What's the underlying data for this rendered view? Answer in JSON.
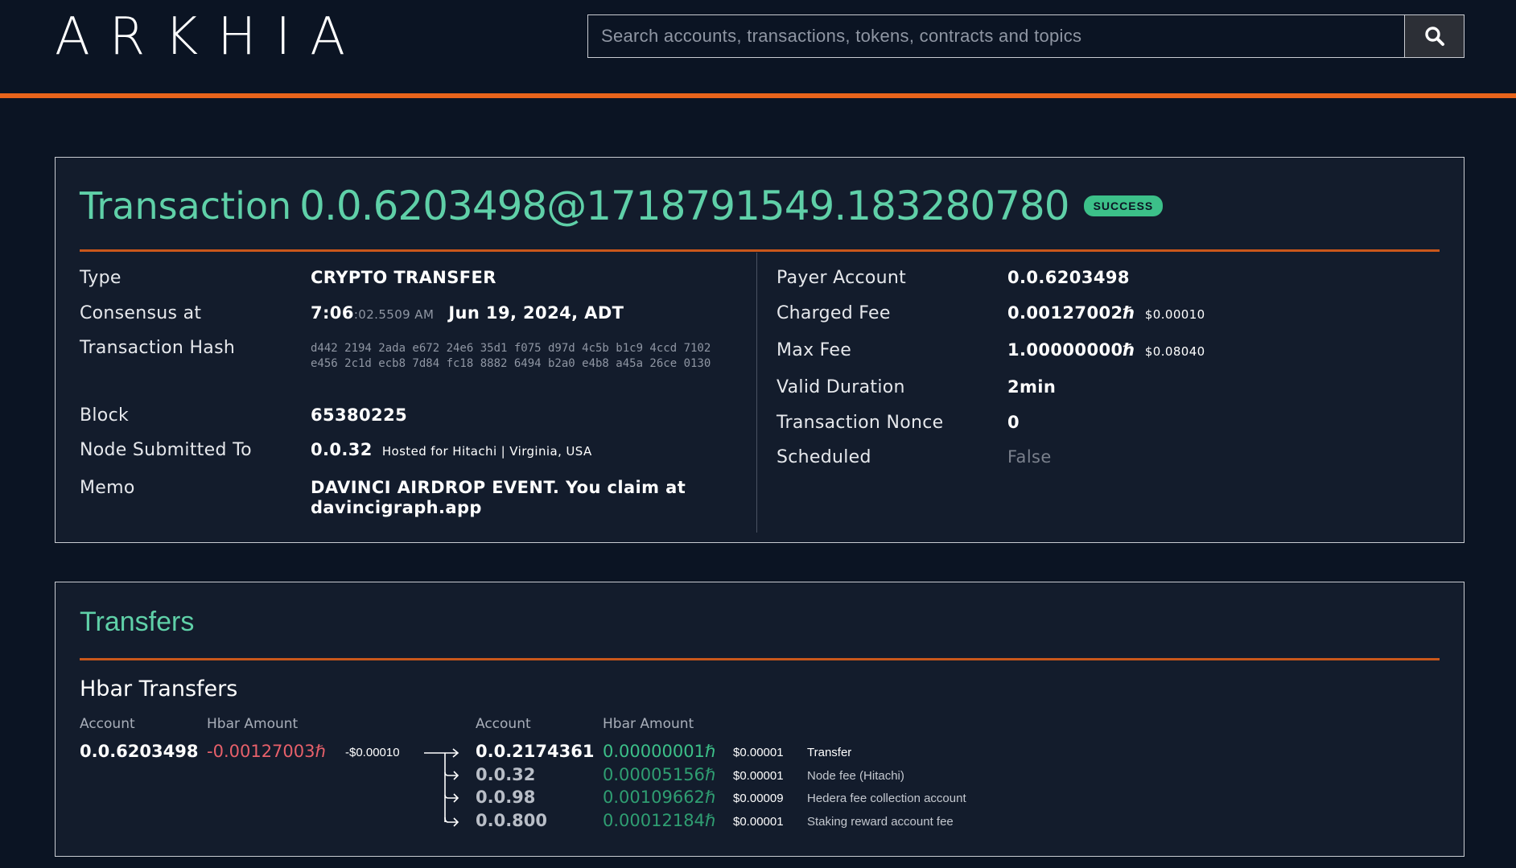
{
  "header": {
    "logo": "ARKHIA",
    "search_placeholder": "Search accounts, transactions, tokens, contracts and topics"
  },
  "transaction": {
    "title_prefix": "Transaction",
    "title_id": "0.0.6203498@1718791549.183280780",
    "status": "SUCCESS",
    "left": {
      "type_label": "Type",
      "type_value": "CRYPTO TRANSFER",
      "consensus_label": "Consensus at",
      "consensus_time": "7:06",
      "consensus_seconds": ":02.5509 AM",
      "consensus_date": "Jun 19, 2024, ADT",
      "hash_label": "Transaction Hash",
      "hash_value": "d442 2194 2ada e672 24e6 35d1 f075 d97d 4c5b b1c9 4ccd 7102 e456 2c1d ecb8 7d84 fc18 8882 6494 b2a0 e4b8 a45a 26ce 0130",
      "block_label": "Block",
      "block_value": "65380225",
      "node_label": "Node Submitted To",
      "node_value": "0.0.32",
      "node_host": "Hosted for Hitachi | Virginia, USA",
      "memo_label": "Memo",
      "memo_value": "DAVINCI AIRDROP EVENT. You claim at davincigraph.app"
    },
    "right": {
      "payer_label": "Payer Account",
      "payer_value": "0.0.6203498",
      "charged_label": "Charged Fee",
      "charged_value": "0.00127002ℏ",
      "charged_usd": "$0.00010",
      "maxfee_label": "Max Fee",
      "maxfee_value": "1.00000000ℏ",
      "maxfee_usd": "$0.08040",
      "duration_label": "Valid Duration",
      "duration_value": "2min",
      "nonce_label": "Transaction Nonce",
      "nonce_value": "0",
      "scheduled_label": "Scheduled",
      "scheduled_value": "False"
    }
  },
  "transfers": {
    "title": "Transfers",
    "hbar_title": "Hbar Transfers",
    "headers": {
      "account": "Account",
      "hbar_amount": "Hbar Amount"
    },
    "from": {
      "account": "0.0.6203498",
      "amount": "-0.00127003ℏ",
      "usd": "-$0.00010"
    },
    "to": [
      {
        "account": "0.0.2174361",
        "amount": "0.00000001ℏ",
        "usd": "$0.00001",
        "desc": "Transfer"
      },
      {
        "account": "0.0.32",
        "amount": "0.00005156ℏ",
        "usd": "$0.00001",
        "desc": "Node fee (Hitachi)"
      },
      {
        "account": "0.0.98",
        "amount": "0.00109662ℏ",
        "usd": "$0.00009",
        "desc": "Hedera fee collection account"
      },
      {
        "account": "0.0.800",
        "amount": "0.00012184ℏ",
        "usd": "$0.00001",
        "desc": "Staking reward account fee"
      }
    ]
  },
  "colors": {
    "accent": "#5fd0a8",
    "orange": "#e8641b",
    "success": "#3cc089",
    "negative": "#e7606a",
    "background": "#0b1423"
  }
}
